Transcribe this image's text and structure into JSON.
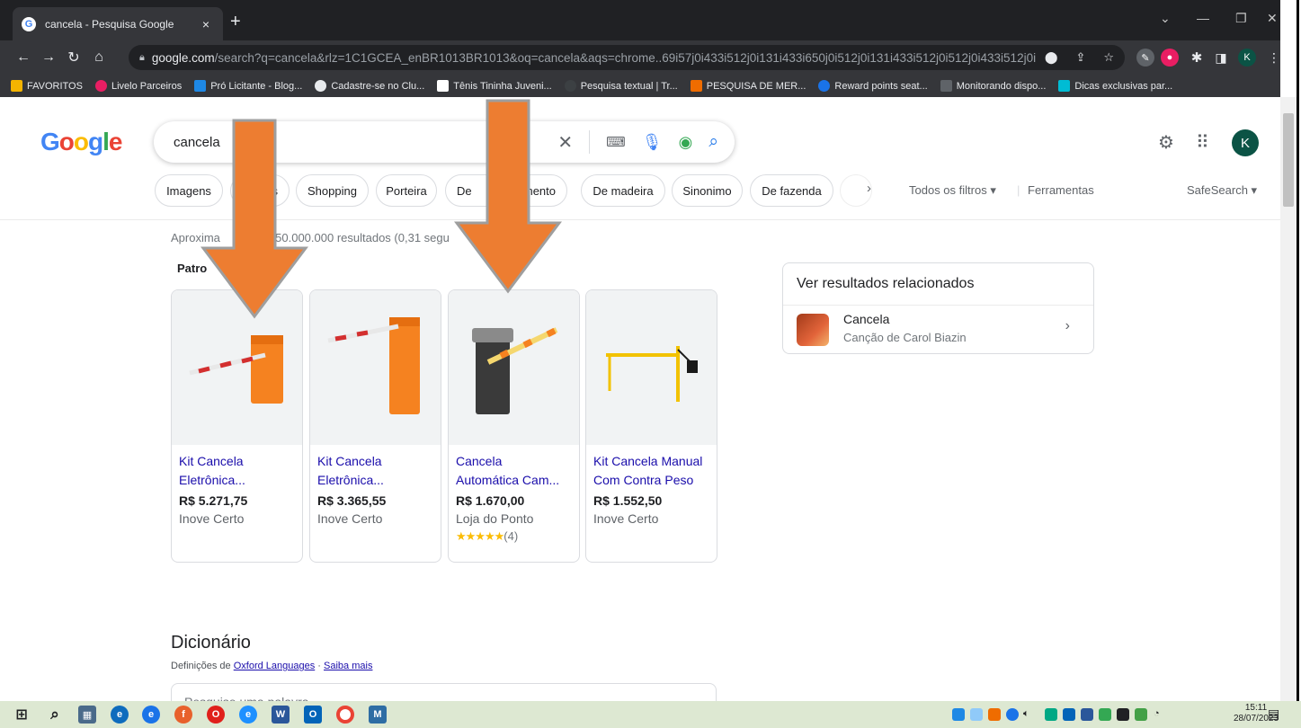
{
  "browser": {
    "tab_title": "cancela - Pesquisa Google",
    "tab_close": "×",
    "new_tab": "+",
    "url_domain": "google.com",
    "url_rest": "/search?q=cancela&rlz=1C1GCEA_enBR1013BR1013&oq=cancela&aqs=chrome..69i57j0i433i512j0i131i433i650j0i512j0i131i433i512j0i512j0i433i512j0i131i43...",
    "profile_initial": "K",
    "bookmarks": [
      "FAVORITOS",
      "Livelo Parceiros",
      "Pró Licitante - Blog...",
      "Cadastre-se no Clu...",
      "Tênis Tininha Juveni...",
      "Pesquisa textual | Tr...",
      "PESQUISA DE MER...",
      "Reward points seat...",
      "Monitorando dispo...",
      "Dicas exclusivas par..."
    ]
  },
  "google": {
    "logo_letters": [
      "G",
      "o",
      "o",
      "g",
      "l",
      "e"
    ],
    "query": "cancela",
    "avatar_initial": "K",
    "chips": [
      "Imagens",
      "s",
      "Shopping",
      "Porteira",
      "De",
      "mento",
      "De madeira",
      "Sinonimo",
      "De fazenda"
    ],
    "all_filters": "Todos os filtros",
    "tools": "Ferramentas",
    "safesearch": "SafeSearch",
    "stats_prefix": "Aproxima",
    "stats_rest": "150.000.000 resultados (0,31 segu",
    "sponsored": "Patro",
    "products": [
      {
        "name_1": "Kit Cancela",
        "name_2": "Eletrônica...",
        "price": "R$ 5.271,75",
        "store": "Inove Certo"
      },
      {
        "name_1": "Kit Cancela",
        "name_2": "Eletrônica...",
        "price": "R$ 3.365,55",
        "store": "Inove Certo"
      },
      {
        "name_1": "Cancela",
        "name_2": "Automática Cam...",
        "price": "R$ 1.670,00",
        "store": "Loja do Ponto",
        "stars": "★★★★★",
        "rating_count": "(4)"
      },
      {
        "name_1": "Kit Cancela Manual",
        "name_2": "Com Contra Peso",
        "price": "R$ 1.552,50",
        "store": "Inove Certo"
      }
    ],
    "related": {
      "title": "Ver resultados relacionados",
      "item_title": "Cancela",
      "item_subtitle": "Canção de Carol Biazin"
    },
    "dictionary": {
      "title": "Dicionário",
      "defs_prefix": "Definições de",
      "oxford": "Oxford Languages",
      "separator": "·",
      "learn_more": "Saiba mais",
      "placeholder": "Pesquise uma palavra"
    }
  },
  "taskbar": {
    "time": "15:11",
    "date": "28/07/2023"
  },
  "colors": {
    "arrow_orange": "#ed7d31",
    "link_blue": "#1a0dab",
    "chrome_dark": "#202124"
  }
}
